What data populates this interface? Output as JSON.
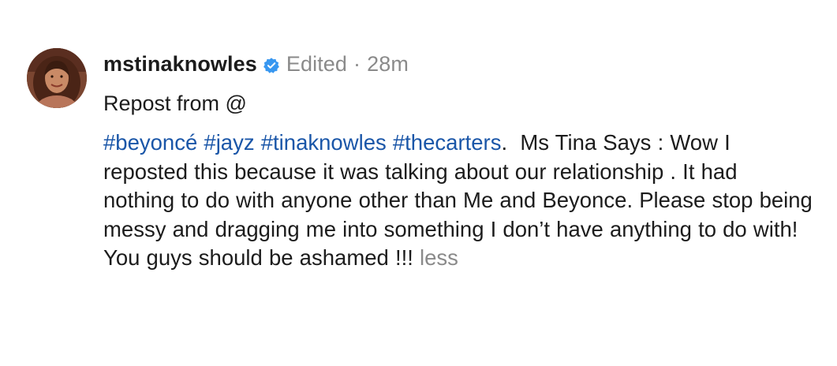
{
  "post": {
    "username": "mstinaknowles",
    "verified_icon": "verified-badge-icon",
    "edited_label": "Edited",
    "separator": "·",
    "time_ago": "28m",
    "repost_text": "Repost from @",
    "hashtags": [
      "#beyoncé",
      "#jayz",
      "#tinaknowles",
      "#thecarters"
    ],
    "hashtag_trailing": ".",
    "caption_text": "Ms Tina Says : Wow I reposted this because it was talking about our relationship . It had nothing to do with anyone other than Me and Beyonce. Please stop being messy and dragging me into something I don’t have anything to do with!  You guys should be ashamed !!!",
    "less_label": "less"
  },
  "colors": {
    "hashtag": "#1a56a8",
    "verified": "#3897f0",
    "meta": "#8a8a8a",
    "text": "#1c1c1c"
  }
}
